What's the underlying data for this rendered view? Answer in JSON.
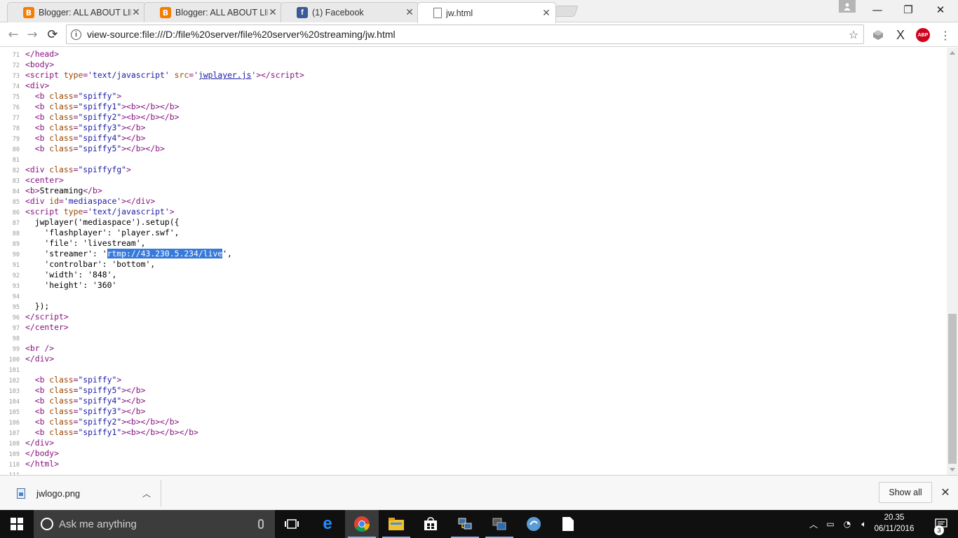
{
  "browser": {
    "tabs": [
      {
        "title": "Blogger: ALL ABOUT LIN",
        "icon": "blogger-icon"
      },
      {
        "title": "Blogger: ALL ABOUT LIN",
        "icon": "blogger-icon"
      },
      {
        "title": "(1) Facebook",
        "icon": "facebook-icon"
      },
      {
        "title": "jw.html",
        "icon": "document-icon",
        "active": true
      }
    ],
    "address": "view-source:file:///D:/file%20server/file%20server%20streaming/jw.html",
    "abp_label": "ABP",
    "facebook_glyph": "f"
  },
  "source": {
    "lines": [
      {
        "n": "71",
        "html": "<span class=\"tag\">&lt;/head&gt;</span>"
      },
      {
        "n": "72",
        "html": "<span class=\"tag\">&lt;body&gt;</span>"
      },
      {
        "n": "73",
        "html": "<span class=\"tag\">&lt;script <span class=\"att\">type</span>=<span class=\"val\">'text/javascript'</span> <span class=\"att\">src</span>=<span class=\"val\">'</span><span class=\"link\">jwplayer.js</span><span class=\"val\">'</span>&gt;&lt;/script&gt;</span>"
      },
      {
        "n": "74",
        "html": "<span class=\"tag\">&lt;div&gt;</span>"
      },
      {
        "n": "75",
        "html": "  <span class=\"tag\">&lt;b <span class=\"att\">class</span>=<span class=\"val\">\"spiffy\"</span>&gt;</span>"
      },
      {
        "n": "76",
        "html": "  <span class=\"tag\">&lt;b <span class=\"att\">class</span>=<span class=\"val\">\"spiffy1\"</span>&gt;&lt;b&gt;&lt;/b&gt;&lt;/b&gt;</span>"
      },
      {
        "n": "77",
        "html": "  <span class=\"tag\">&lt;b <span class=\"att\">class</span>=<span class=\"val\">\"spiffy2\"</span>&gt;&lt;b&gt;&lt;/b&gt;&lt;/b&gt;</span>"
      },
      {
        "n": "78",
        "html": "  <span class=\"tag\">&lt;b <span class=\"att\">class</span>=<span class=\"val\">\"spiffy3\"</span>&gt;&lt;/b&gt;</span>"
      },
      {
        "n": "79",
        "html": "  <span class=\"tag\">&lt;b <span class=\"att\">class</span>=<span class=\"val\">\"spiffy4\"</span>&gt;&lt;/b&gt;</span>"
      },
      {
        "n": "80",
        "html": "  <span class=\"tag\">&lt;b <span class=\"att\">class</span>=<span class=\"val\">\"spiffy5\"</span>&gt;&lt;/b&gt;&lt;/b&gt;</span>"
      },
      {
        "n": "81",
        "html": ""
      },
      {
        "n": "82",
        "html": "<span class=\"tag\">&lt;div <span class=\"att\">class</span>=<span class=\"val\">\"spiffyfg\"</span>&gt;</span>"
      },
      {
        "n": "83",
        "html": "<span class=\"tag\">&lt;center&gt;</span>"
      },
      {
        "n": "84",
        "html": "<span class=\"tag\">&lt;b&gt;</span>Streaming<span class=\"tag\">&lt;/b&gt;</span>"
      },
      {
        "n": "85",
        "html": "<span class=\"tag\">&lt;div <span class=\"att\">id</span>=<span class=\"val\">'mediaspace'</span>&gt;&lt;/div&gt;</span>"
      },
      {
        "n": "86",
        "html": "<span class=\"tag\">&lt;script <span class=\"att\">type</span>=<span class=\"val\">'text/javascript'</span>&gt;</span>"
      },
      {
        "n": "87",
        "html": "  jwplayer('mediaspace').setup({"
      },
      {
        "n": "88",
        "html": "    'flashplayer': 'player.swf',"
      },
      {
        "n": "89",
        "html": "    'file': 'livestream',"
      },
      {
        "n": "90",
        "html": "    'streamer': '<span class=\"sel\">rtmp://43.230.5.234/live</span>',"
      },
      {
        "n": "91",
        "html": "    'controlbar': 'bottom',"
      },
      {
        "n": "92",
        "html": "    'width': '848',"
      },
      {
        "n": "93",
        "html": "    'height': '360'"
      },
      {
        "n": "94",
        "html": ""
      },
      {
        "n": "95",
        "html": "  });"
      },
      {
        "n": "96",
        "html": "<span class=\"tag\">&lt;/script&gt;</span>"
      },
      {
        "n": "97",
        "html": "<span class=\"tag\">&lt;/center&gt;</span>"
      },
      {
        "n": "98",
        "html": ""
      },
      {
        "n": "99",
        "html": "<span class=\"tag\">&lt;br /&gt;</span>"
      },
      {
        "n": "100",
        "html": "<span class=\"tag\">&lt;/div&gt;</span>"
      },
      {
        "n": "101",
        "html": ""
      },
      {
        "n": "102",
        "html": "  <span class=\"tag\">&lt;b <span class=\"att\">class</span>=<span class=\"val\">\"spiffy\"</span>&gt;</span>"
      },
      {
        "n": "103",
        "html": "  <span class=\"tag\">&lt;b <span class=\"att\">class</span>=<span class=\"val\">\"spiffy5\"</span>&gt;&lt;/b&gt;</span>"
      },
      {
        "n": "104",
        "html": "  <span class=\"tag\">&lt;b <span class=\"att\">class</span>=<span class=\"val\">\"spiffy4\"</span>&gt;&lt;/b&gt;</span>"
      },
      {
        "n": "105",
        "html": "  <span class=\"tag\">&lt;b <span class=\"att\">class</span>=<span class=\"val\">\"spiffy3\"</span>&gt;&lt;/b&gt;</span>"
      },
      {
        "n": "106",
        "html": "  <span class=\"tag\">&lt;b <span class=\"att\">class</span>=<span class=\"val\">\"spiffy2\"</span>&gt;&lt;b&gt;&lt;/b&gt;&lt;/b&gt;</span>"
      },
      {
        "n": "107",
        "html": "  <span class=\"tag\">&lt;b <span class=\"att\">class</span>=<span class=\"val\">\"spiffy1\"</span>&gt;&lt;b&gt;&lt;/b&gt;&lt;/b&gt;&lt;/b&gt;</span>"
      },
      {
        "n": "108",
        "html": "<span class=\"tag\">&lt;/div&gt;</span>"
      },
      {
        "n": "109",
        "html": "<span class=\"tag\">&lt;/body&gt;</span>"
      },
      {
        "n": "110",
        "html": "<span class=\"tag\">&lt;/html&gt;</span>"
      },
      {
        "n": "111",
        "html": ""
      }
    ]
  },
  "downloads": {
    "item_name": "jwlogo.png",
    "show_all_label": "Show all"
  },
  "taskbar": {
    "search_placeholder": "Ask me anything",
    "time": "20.35",
    "date": "06/11/2016",
    "notification_count": "3",
    "apps": [
      "task-view-icon",
      "edge-icon",
      "chrome-icon",
      "file-explorer-icon",
      "store-icon",
      "network-app-icon",
      "app-icon",
      "app-circle-icon",
      "notepad-icon"
    ]
  },
  "colors": {
    "tag": "#881280",
    "attribute": "#994500",
    "value": "#1a1aa6",
    "selection": "#3879d9",
    "taskbar": "#101010"
  }
}
